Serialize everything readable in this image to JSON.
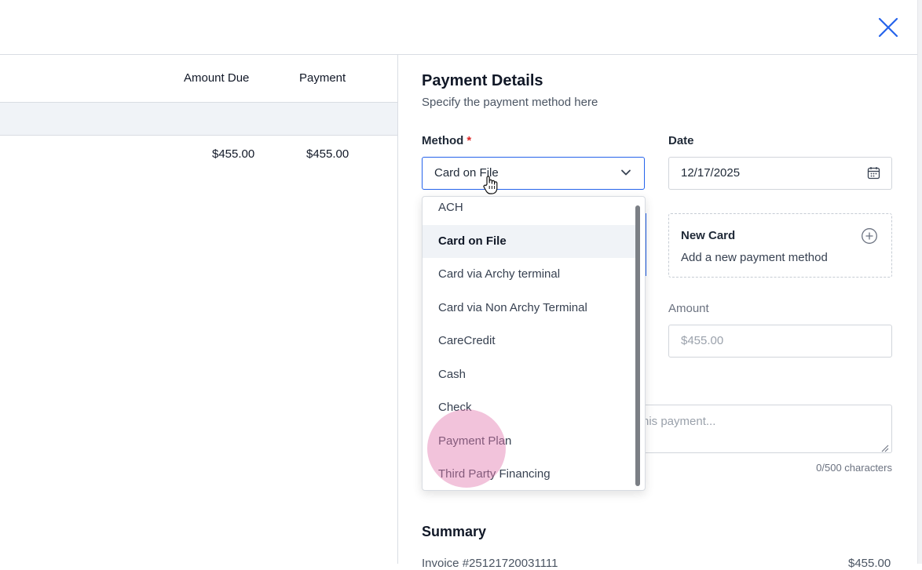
{
  "header": {
    "close_icon": "close-icon"
  },
  "table": {
    "columns": [
      "Amount Due",
      "Payment"
    ],
    "rows": [
      {
        "amount_due": "$455.00",
        "payment": "$455.00"
      }
    ]
  },
  "payment_details": {
    "title": "Payment Details",
    "subtitle": "Specify the payment method here",
    "method": {
      "label": "Method",
      "required_mark": "*",
      "value": "Card on File",
      "options": [
        "ACH",
        "Card on File",
        "Card via Archy terminal",
        "Card via Non Archy Terminal",
        "CareCredit",
        "Cash",
        "Check",
        "Payment Plan",
        "Third Party Financing"
      ],
      "selected_index": 1
    },
    "date": {
      "label": "Date",
      "value": "12/17/2025",
      "icon": "calendar-icon"
    },
    "new_card": {
      "title": "New Card",
      "subtitle": "Add a new payment method",
      "icon": "plus-circle-icon"
    },
    "amount": {
      "label": "Amount",
      "placeholder": "$455.00"
    },
    "notes": {
      "placeholder_visible": "his payment...",
      "counter": "0/500 characters"
    },
    "summary": {
      "title": "Summary",
      "partial_left": "Invoice #25121720031111",
      "partial_right": "$455.00"
    }
  },
  "colors": {
    "accent": "#2563eb",
    "required": "#dc2626",
    "selected_bg": "#f0f3f7",
    "click_indicator": "#e27ab0"
  }
}
